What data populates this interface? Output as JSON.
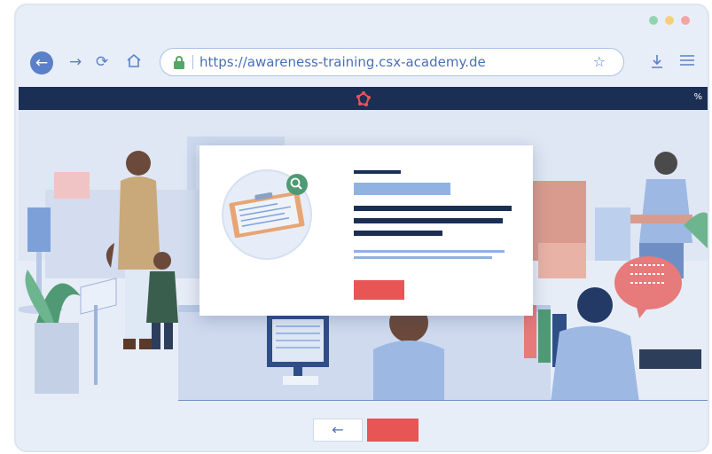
{
  "browser": {
    "url": "https://awareness-training.csx-academy.de",
    "icons": [
      "back-icon",
      "forward-icon",
      "reload-icon",
      "home-icon",
      "lock-icon",
      "star-icon",
      "download-icon",
      "menu-icon"
    ],
    "dots": [
      "#8fd6b0",
      "#f7cf7a",
      "#f5a3a3"
    ],
    "accent": "#5b7fc9"
  },
  "course": {
    "progress_label": "%",
    "brand_color": "#1b2f55",
    "accent_red": "#e85555",
    "back_label": "←"
  }
}
